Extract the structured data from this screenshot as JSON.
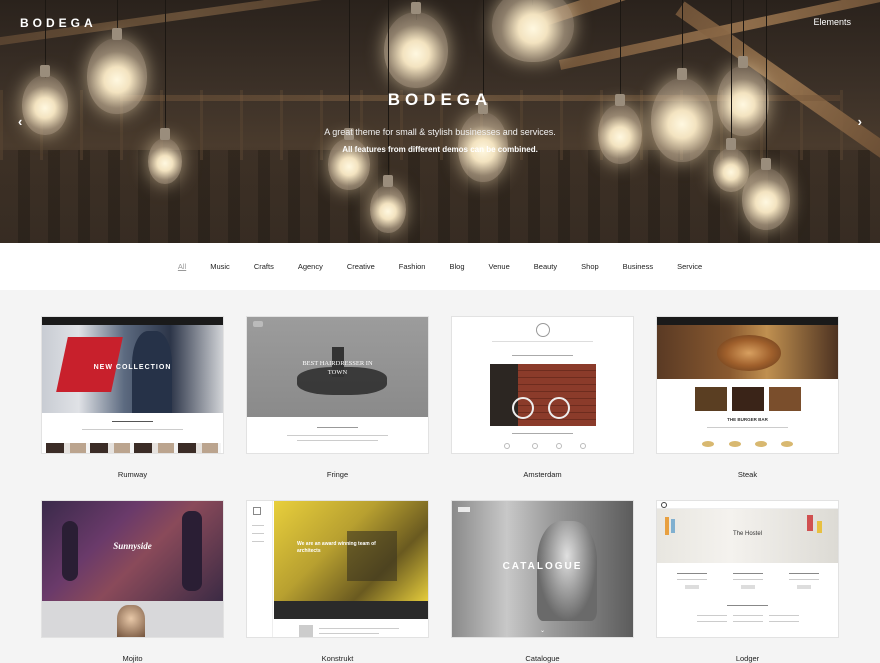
{
  "header": {
    "brand": "BODEGA",
    "top_link": "Elements"
  },
  "hero": {
    "title": "BODEGA",
    "subtitle": "A great theme for small & stylish businesses and services.",
    "subtitle2": "All features from different demos can be combined.",
    "prev_arrow": "‹",
    "next_arrow": "›"
  },
  "filters": [
    "All",
    "Music",
    "Crafts",
    "Agency",
    "Creative",
    "Fashion",
    "Blog",
    "Venue",
    "Beauty",
    "Shop",
    "Business",
    "Service"
  ],
  "active_filter": "All",
  "demos": [
    {
      "name": "Rumway",
      "overlay": "NEW COLLECTION"
    },
    {
      "name": "Fringe",
      "overlay": "BEST HAIRDRESSER IN TOWN"
    },
    {
      "name": "Amsterdam",
      "overlay": ""
    },
    {
      "name": "Steak",
      "overlay": "THE BURGER BAR"
    },
    {
      "name": "Mojito",
      "overlay": "Sunnyside"
    },
    {
      "name": "Konstrukt",
      "overlay": "We are an award winning team of architects"
    },
    {
      "name": "Catalogue",
      "overlay": "CATALOGUE"
    },
    {
      "name": "Lodger",
      "overlay": "The Hostel"
    }
  ],
  "colors": {
    "accent_yellow": "#e8cf3c",
    "page_bg": "#f4f4f4"
  }
}
